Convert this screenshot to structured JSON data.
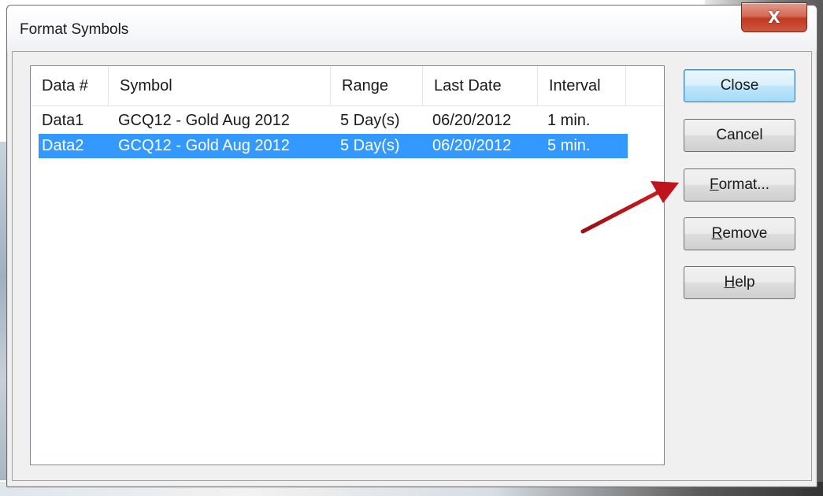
{
  "window": {
    "title": "Format Symbols",
    "close_glyph": "X"
  },
  "list": {
    "columns": [
      "Data #",
      "Symbol",
      "Range",
      "Last Date",
      "Interval"
    ],
    "rows": [
      {
        "data": "Data1",
        "symbol": "GCQ12 - Gold Aug 2012",
        "range": "5 Day(s)",
        "last_date": "06/20/2012",
        "interval": "1 min.",
        "selected": false
      },
      {
        "data": "Data2",
        "symbol": "GCQ12 - Gold Aug 2012",
        "range": "5 Day(s)",
        "last_date": "06/20/2012",
        "interval": "5 min.",
        "selected": true
      }
    ]
  },
  "buttons": {
    "close": "Close",
    "cancel": "Cancel",
    "format": {
      "mnemonic": "F",
      "rest": "ormat..."
    },
    "remove": {
      "mnemonic": "R",
      "rest": "emove"
    },
    "help": {
      "mnemonic": "H",
      "rest": "elp"
    }
  },
  "colors": {
    "selection": "#3399ff",
    "annotation_arrow": "#c0141c",
    "close_button": "#c8422b"
  },
  "icons": {
    "close": "close-icon",
    "annotation": "arrow-annotation"
  }
}
